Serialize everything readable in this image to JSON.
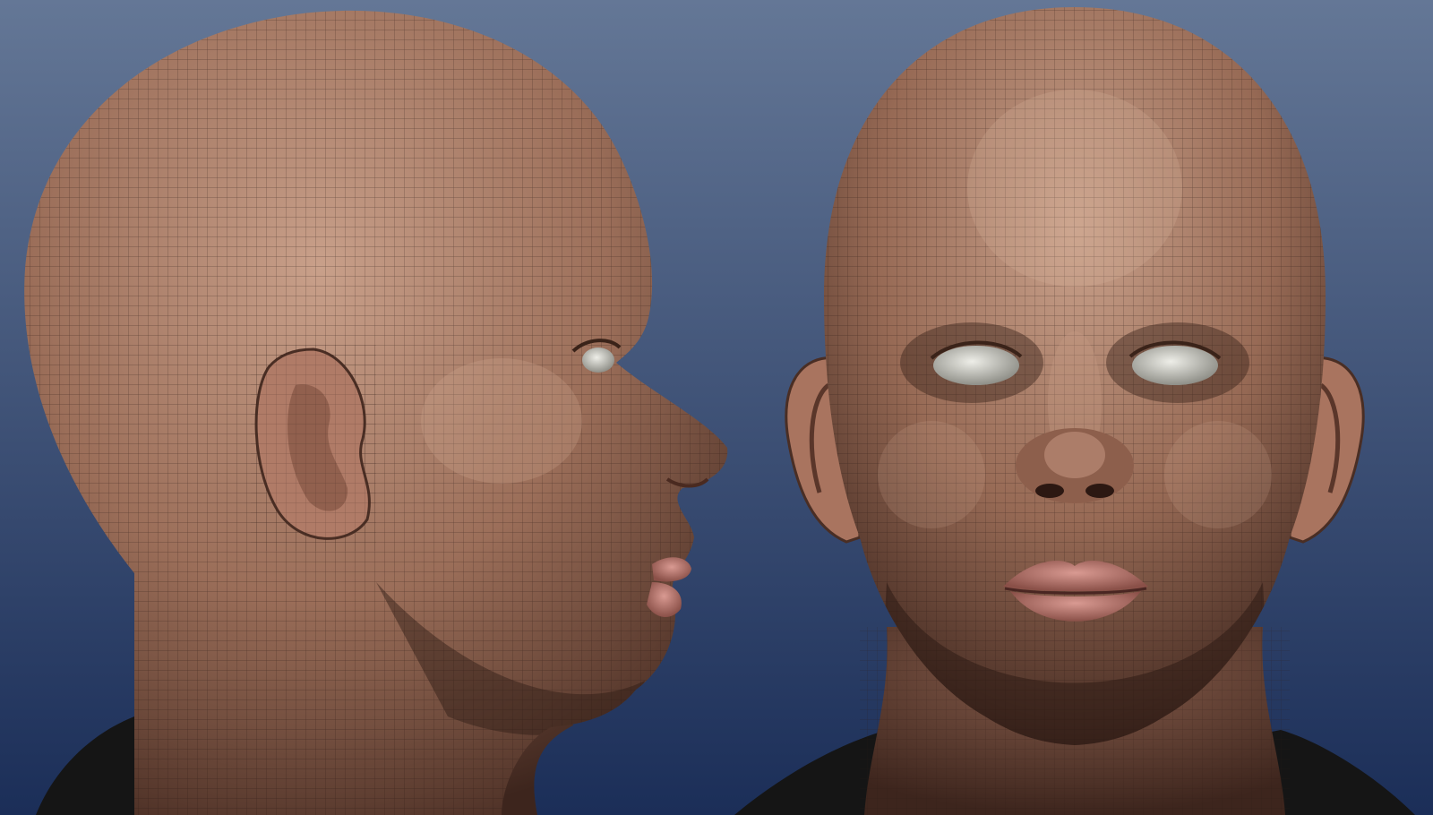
{
  "scene": {
    "colors": {
      "background_top": "#647796",
      "background_bottom": "#1b2e58",
      "skin_light": "#c9a08a",
      "skin_mid": "#9b6e59",
      "skin_dark": "#4a2e24",
      "wireframe": "#2b1a14",
      "shirt": "#151515",
      "eye": "#d8d8d2",
      "lip": "#c98983"
    },
    "views": [
      {
        "name": "side-profile-view"
      },
      {
        "name": "front-view"
      }
    ]
  }
}
